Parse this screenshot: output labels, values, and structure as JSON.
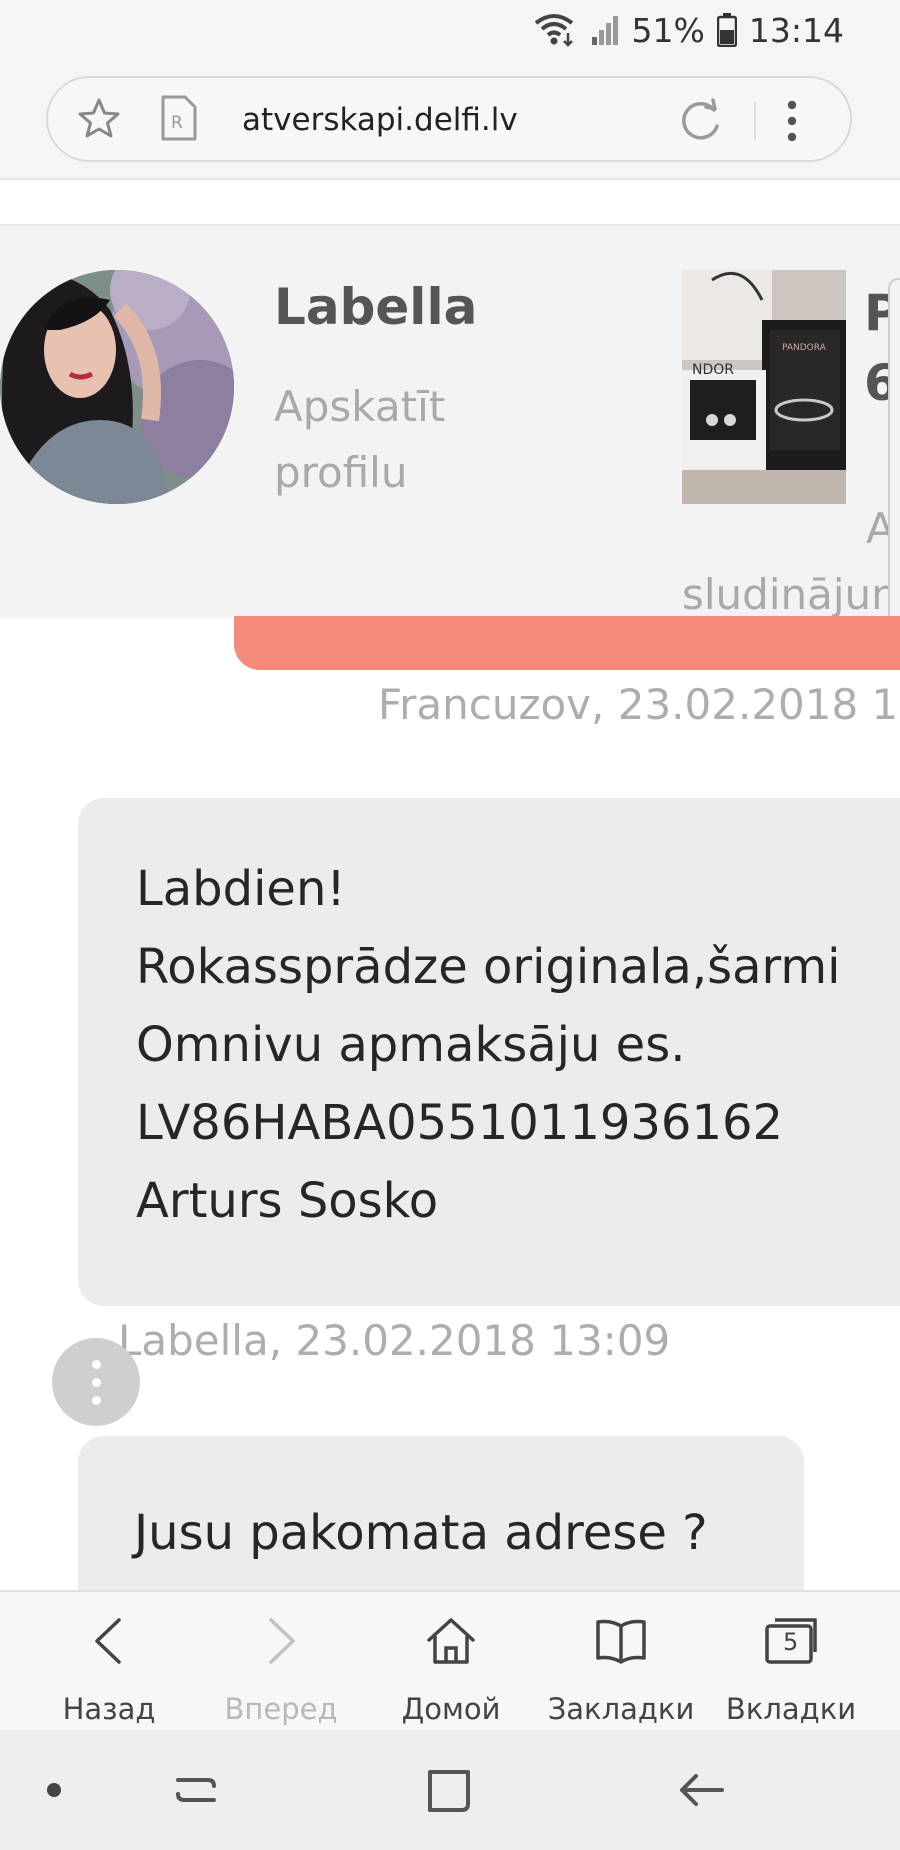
{
  "status_bar": {
    "battery": "51%",
    "time": "13:14"
  },
  "browser": {
    "url": "atverskapi.delfi.lv"
  },
  "header": {
    "user_name": "Labella",
    "view_profile": "Apskatīt profilu",
    "product_title_partial": "P\n6",
    "product_link_line1": "Ap",
    "product_link_line2": "sludinājum"
  },
  "messages": [
    {
      "author_meta": "Francuzov, 23.02.2018 1"
    },
    {
      "lines": [
        "Labdien!",
        "Rokassprādze originala,šarmi",
        "Omnivu apmaksāju es.",
        "LV86HABA0551011936162",
        "Arturs Sosko"
      ],
      "author_meta": "Labella, 23.02.2018 13:09"
    },
    {
      "lines": [
        "Jusu pakomata adrese ?"
      ]
    }
  ],
  "toolbar": {
    "back": "Назад",
    "forward": "Вперед",
    "home": "Домой",
    "bookmarks": "Закладки",
    "tabs": "Вкладки",
    "tabs_count": "5"
  },
  "colors": {
    "accent_bubble": "#f58a7a",
    "received_bubble": "#ececec",
    "header_bg": "#f3f3f3"
  },
  "icons": {
    "status": [
      "wifi-icon",
      "signal-icon",
      "battery-icon"
    ],
    "address_bar": [
      "star-icon",
      "reader-mode-icon",
      "reload-icon",
      "more-vert-icon"
    ],
    "toolbar": [
      "chevron-left-icon",
      "chevron-right-icon",
      "home-icon",
      "book-icon",
      "tabs-icon"
    ],
    "navbar": [
      "dot-icon",
      "recent-apps-icon",
      "home-square-icon",
      "back-arrow-icon"
    ]
  }
}
